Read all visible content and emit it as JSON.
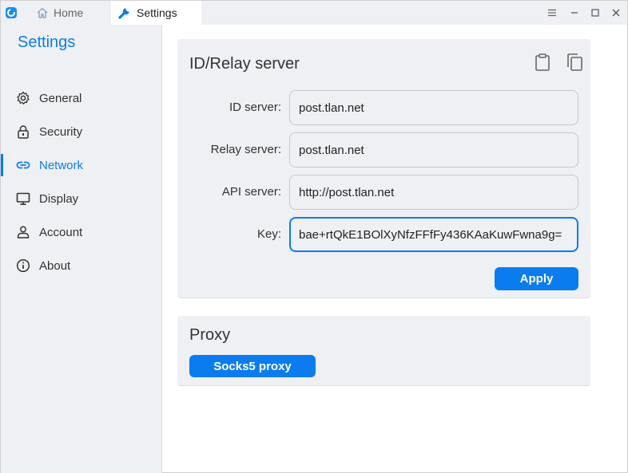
{
  "tabs": {
    "home_label": "Home",
    "settings_label": "Settings"
  },
  "sidebar": {
    "title": "Settings",
    "items": [
      {
        "label": "General",
        "icon": "gear-icon"
      },
      {
        "label": "Security",
        "icon": "lock-icon"
      },
      {
        "label": "Network",
        "icon": "link-icon",
        "active": true
      },
      {
        "label": "Display",
        "icon": "monitor-icon"
      },
      {
        "label": "Account",
        "icon": "person-icon"
      },
      {
        "label": "About",
        "icon": "info-icon"
      }
    ]
  },
  "relay_card": {
    "title": "ID/Relay server",
    "fields": [
      {
        "label": "ID server:",
        "value": "post.tlan.net"
      },
      {
        "label": "Relay server:",
        "value": "post.tlan.net"
      },
      {
        "label": "API server:",
        "value": "http://post.tlan.net"
      },
      {
        "label": "Key:",
        "value": "bae+rtQkE1BOlXyNfzFFfFy436KAaKuwFwna9g="
      }
    ],
    "apply_label": "Apply"
  },
  "proxy_card": {
    "title": "Proxy",
    "socks_label": "Socks5 proxy"
  },
  "colors": {
    "accent": "#0a7cf0",
    "panel_bg": "#eff0f3"
  }
}
